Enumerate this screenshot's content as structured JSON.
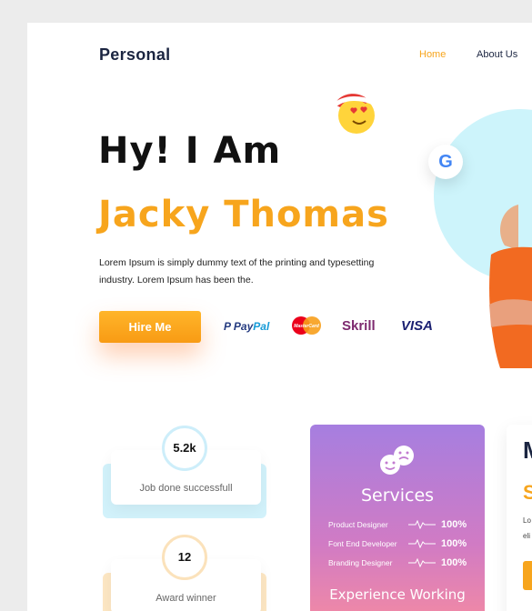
{
  "nav": {
    "logo": "Personal",
    "home": "Home",
    "about": "About Us"
  },
  "hero": {
    "line1": "Hy! I Am",
    "name": "Jacky Thomas",
    "description": "Lorem Ipsum is simply dummy text of the printing and typesetting industry. Lorem Ipsum has been the.",
    "cta": "Hire Me"
  },
  "payments": {
    "paypal_a": "Pay",
    "paypal_b": "Pal",
    "mastercard": "MasterCard",
    "skrill": "Skrill",
    "visa": "VISA"
  },
  "google_letter": "G",
  "stats": [
    {
      "value": "5.2k",
      "label": "Job done successfull",
      "color": "#d2f2fb"
    },
    {
      "value": "12",
      "label": "Award winner",
      "color": "#fde7c4"
    }
  ],
  "services": {
    "title": "Services",
    "rows": [
      {
        "label": "Product Designer",
        "value": "100%"
      },
      {
        "label": "Font End Developer",
        "value": "100%"
      },
      {
        "label": "Branding Designer",
        "value": "100%"
      }
    ],
    "footer": "Experience Working"
  },
  "right_card": {
    "m": "M",
    "s": "S",
    "t1": "Lo",
    "t2": "eli"
  },
  "colors": {
    "accent": "#f7a51d",
    "navy": "#1b2541"
  }
}
